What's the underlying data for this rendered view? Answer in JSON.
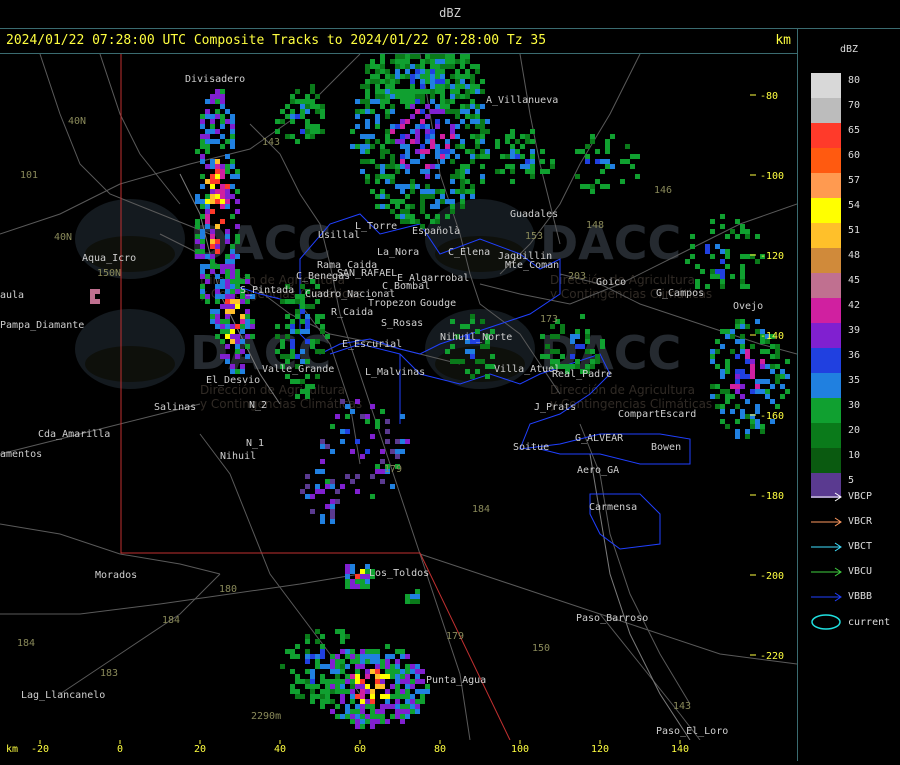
{
  "topbar": {
    "title": "dBZ"
  },
  "header": {
    "text": "2024/01/22 07:28:00 UTC Composite Tracks to 2024/01/22 07:28:00 Tz 35",
    "unit": "km"
  },
  "axes": {
    "x_unit": "km",
    "x_ticks": [
      "-20",
      "0",
      "20",
      "40",
      "60",
      "80",
      "100",
      "120",
      "140"
    ],
    "y_ticks": [
      "-80",
      "-100",
      "-120",
      "-140",
      "-160",
      "-180",
      "-200",
      "-220"
    ]
  },
  "legend": {
    "title": "dBZ",
    "scale": [
      {
        "value": "80",
        "color": "#d8d8d8"
      },
      {
        "value": "70",
        "color": "#bcbcbc"
      },
      {
        "value": "65",
        "color": "#ff3a2a"
      },
      {
        "value": "60",
        "color": "#ff5a10"
      },
      {
        "value": "57",
        "color": "#ff9a50"
      },
      {
        "value": "54",
        "color": "#ffff00"
      },
      {
        "value": "51",
        "color": "#ffc02a"
      },
      {
        "value": "48",
        "color": "#d08a3a"
      },
      {
        "value": "45",
        "color": "#c07090"
      },
      {
        "value": "42",
        "color": "#d020a0"
      },
      {
        "value": "39",
        "color": "#8020d0"
      },
      {
        "value": "36",
        "color": "#2040e0"
      },
      {
        "value": "35",
        "color": "#2080e0"
      },
      {
        "value": "30",
        "color": "#10a030"
      },
      {
        "value": "20",
        "color": "#0a7a1a"
      },
      {
        "value": "10",
        "color": "#0a5a10"
      },
      {
        "value": "5",
        "color": "#5a3a90"
      }
    ],
    "tracks": [
      {
        "label": "VBCP",
        "color": "#ffffff"
      },
      {
        "label": "VBCR",
        "color": "#ff9a60"
      },
      {
        "label": "VBCT",
        "color": "#40e0ff"
      },
      {
        "label": "VBCU",
        "color": "#40d040"
      },
      {
        "label": "VBBB",
        "color": "#2040ff"
      }
    ],
    "current_label": "current",
    "current_color": "#20e0e0"
  },
  "watermark": {
    "brand": "DACC",
    "line1": "Dirección de Agricultura",
    "line2": "y Contingencias Climáticas"
  },
  "places": [
    {
      "name": "Divisadero"
    },
    {
      "name": "A_Villanueva"
    },
    {
      "name": "Guadales"
    },
    {
      "name": "Usillal"
    },
    {
      "name": "L_Torre"
    },
    {
      "name": "Españolà"
    },
    {
      "name": "C_Elena"
    },
    {
      "name": "Jaquillin"
    },
    {
      "name": "Aqua_Icro"
    },
    {
      "name": "Pampa_Diamante"
    },
    {
      "name": "La_Nora"
    },
    {
      "name": "SAN_RAFAEL"
    },
    {
      "name": "C_Benegas"
    },
    {
      "name": "E_Algarrobal"
    },
    {
      "name": "C_Bombal"
    },
    {
      "name": "Tropezon"
    },
    {
      "name": "Goudge"
    },
    {
      "name": "Goico"
    },
    {
      "name": "G_Campos"
    },
    {
      "name": "S_Pintada"
    },
    {
      "name": "R_Caida"
    },
    {
      "name": "S_Rosas"
    },
    {
      "name": "E_Escurial"
    },
    {
      "name": "Nihuil_Norte"
    },
    {
      "name": "Valle_Grande"
    },
    {
      "name": "L_Malvinas"
    },
    {
      "name": "El_Desvio"
    },
    {
      "name": "Salinas"
    },
    {
      "name": "Cda_Amarilla"
    },
    {
      "name": "N_2"
    },
    {
      "name": "N_1"
    },
    {
      "name": "Nihuil"
    },
    {
      "name": "J_Prats"
    },
    {
      "name": "CompartEscard"
    },
    {
      "name": "G_ALVEAR"
    },
    {
      "name": "Soitue"
    },
    {
      "name": "Bowen"
    },
    {
      "name": "Aero_GA"
    },
    {
      "name": "Carmensa"
    },
    {
      "name": "Morados"
    },
    {
      "name": "Los_Toldos"
    },
    {
      "name": "Paso_Barroso"
    },
    {
      "name": "Punta_Agua"
    },
    {
      "name": "Lag_Llancanelo"
    },
    {
      "name": "Paso_El_Loro"
    },
    {
      "name": "Ovejo"
    },
    {
      "name": "Rama_Caida"
    },
    {
      "name": "Mte_Coman"
    },
    {
      "name": "Villa_Atuel"
    },
    {
      "name": "Real_Padre"
    },
    {
      "name": "amentos"
    },
    {
      "name": "aula"
    },
    {
      "name": "Cuadro_Nacional"
    }
  ],
  "route_labels": [
    "143",
    "146",
    "148",
    "153",
    "203",
    "101",
    "40N",
    "40N",
    "150N",
    "179",
    "184",
    "180",
    "184",
    "183",
    "184",
    "179",
    "150",
    "143",
    "2290m",
    "173"
  ]
}
